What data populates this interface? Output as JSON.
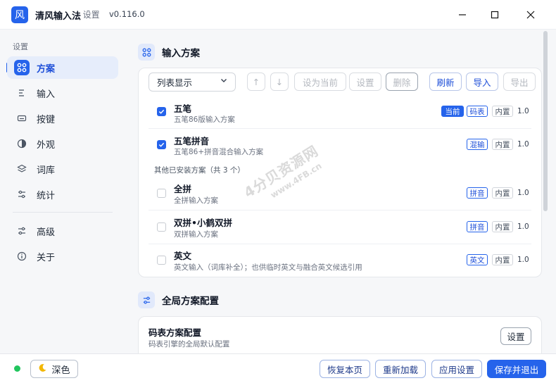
{
  "window": {
    "logo_glyph": "风",
    "app_name": "清风输入法",
    "separator": "· 设置",
    "version": "v0.116.0"
  },
  "sidebar": {
    "heading": "设置",
    "items": [
      {
        "label": "方案",
        "icon": "scheme-grid-icon",
        "active": true
      },
      {
        "label": "输入",
        "icon": "input-lines-icon"
      },
      {
        "label": "按键",
        "icon": "keyboard-icon"
      },
      {
        "label": "外观",
        "icon": "appearance-icon"
      },
      {
        "label": "词库",
        "icon": "layers-icon"
      },
      {
        "label": "统计",
        "icon": "sliders-icon"
      },
      {
        "label": "高级",
        "icon": "advanced-sliders-icon"
      },
      {
        "label": "关于",
        "icon": "info-icon"
      }
    ]
  },
  "schemes_section": {
    "title": "输入方案",
    "view_select": "列表显示",
    "toolbar": {
      "up": "↑",
      "down": "↓",
      "set_current": "设为当前",
      "settings": "设置",
      "delete": "删除",
      "refresh": "刷新",
      "import": "导入",
      "export": "导出"
    },
    "enabled": [
      {
        "name": "五笔",
        "desc": "五笔86版输入方案",
        "checked": true,
        "tags": [
          "当前",
          "码表"
        ],
        "builtin": "内置",
        "version": "1.0"
      },
      {
        "name": "五笔拼音",
        "desc": "五笔86+拼音混合输入方案",
        "checked": true,
        "tags": [
          "混输"
        ],
        "builtin": "内置",
        "version": "1.0"
      }
    ],
    "other_header": "其他已安装方案（共 3 个）",
    "others": [
      {
        "name": "全拼",
        "desc": "全拼输入方案",
        "checked": false,
        "tags": [
          "拼音"
        ],
        "builtin": "内置",
        "version": "1.0"
      },
      {
        "name": "双拼•小鹤双拼",
        "desc": "双拼输入方案",
        "checked": false,
        "tags": [
          "拼音"
        ],
        "builtin": "内置",
        "version": "1.0"
      },
      {
        "name": "英文",
        "desc": "英文输入（词库补全）；也供临时英文与融合英文候选引用",
        "checked": false,
        "tags": [
          "英文"
        ],
        "builtin": "内置",
        "version": "1.0"
      }
    ]
  },
  "global_section": {
    "title": "全局方案配置",
    "config_title": "码表方案配置",
    "config_desc": "码表引擎的全局默认配置",
    "config_button": "设置"
  },
  "watermark": {
    "line1": "4分贝资源网",
    "line2": "www.4FB.cn"
  },
  "footer": {
    "theme_button": "深色",
    "restore": "恢复本页",
    "reload": "重新加载",
    "apply": "应用设置",
    "save_exit": "保存并退出"
  },
  "colors": {
    "accent": "#2563eb",
    "status_online": "#22c55e"
  }
}
